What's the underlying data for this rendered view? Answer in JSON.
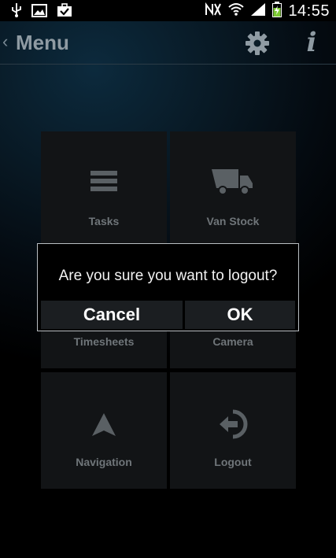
{
  "status_bar": {
    "time": "14:55",
    "left_icons": [
      "usb-icon",
      "image-icon",
      "briefcase-check-icon"
    ],
    "right_icons": [
      "nfc-icon",
      "wifi-icon",
      "signal-icon",
      "battery-charging-icon"
    ]
  },
  "header": {
    "back_glyph": "‹",
    "title": "Menu",
    "info_glyph": "i"
  },
  "tiles": [
    {
      "label": "Tasks",
      "icon": "list-icon"
    },
    {
      "label": "Van Stock",
      "icon": "truck-icon"
    },
    {
      "label": "Timesheets",
      "icon": "clock-icon"
    },
    {
      "label": "Camera",
      "icon": "camera-icon"
    },
    {
      "label": "Navigation",
      "icon": "navigation-arrow-icon"
    },
    {
      "label": "Logout",
      "icon": "logout-icon"
    }
  ],
  "dialog": {
    "message": "Are you sure you want to logout?",
    "cancel_label": "Cancel",
    "ok_label": "OK"
  },
  "colors": {
    "tile_bg": "#121416",
    "tile_text": "#6f7579",
    "header_text": "#8f9ba3",
    "dialog_border": "#b9bec2"
  }
}
